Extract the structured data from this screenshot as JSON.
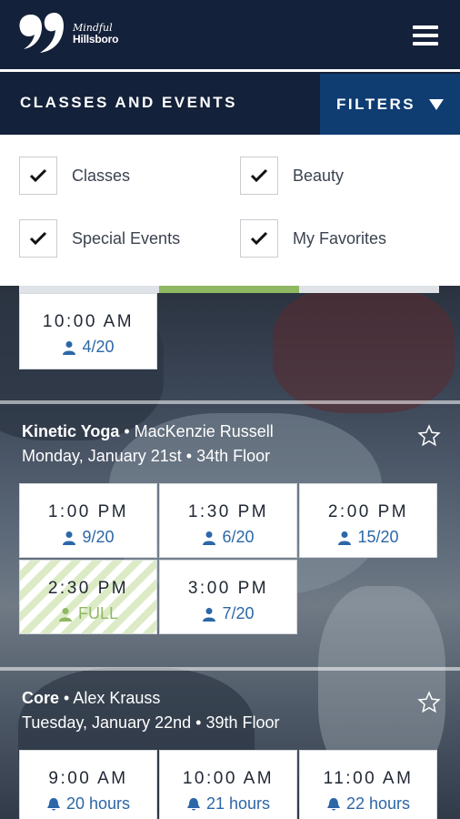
{
  "app": {
    "logo_line1": "Mindful",
    "logo_line2": "Hillsboro"
  },
  "header": {
    "title": "CLASSES AND EVENTS",
    "filters_label": "FILTERS"
  },
  "filters": [
    {
      "label": "Classes",
      "checked": true
    },
    {
      "label": "Beauty",
      "checked": true
    },
    {
      "label": "Special Events",
      "checked": true
    },
    {
      "label": "My Favorites",
      "checked": true
    }
  ],
  "first_class": {
    "slots": [
      {
        "time": "10:00 AM",
        "capacity": "4/20"
      }
    ]
  },
  "classes": [
    {
      "name": "Kinetic Yoga",
      "instructor": "MacKenzie Russell",
      "date": "Monday, January 21st",
      "floor": "34th Floor",
      "slots": [
        {
          "time": "1:00 PM",
          "capacity": "9/20"
        },
        {
          "time": "1:30 PM",
          "capacity": "6/20"
        },
        {
          "time": "2:00 PM",
          "capacity": "15/20"
        },
        {
          "time": "2:30 PM",
          "capacity": "FULL"
        },
        {
          "time": "3:00 PM",
          "capacity": "7/20"
        }
      ]
    },
    {
      "name": "Core",
      "instructor": "Alex Krauss",
      "date": "Tuesday, January 22nd",
      "floor": "39th Floor",
      "slots": [
        {
          "time": "9:00 AM",
          "capacity": "20 hours"
        },
        {
          "time": "10:00 AM",
          "capacity": "21 hours"
        },
        {
          "time": "11:00 AM",
          "capacity": "22 hours"
        }
      ]
    }
  ],
  "colors": {
    "navy": "#14213a",
    "filter_blue": "#0f3c71",
    "accent_green": "#8fb862",
    "link_blue": "#2c67a7"
  }
}
